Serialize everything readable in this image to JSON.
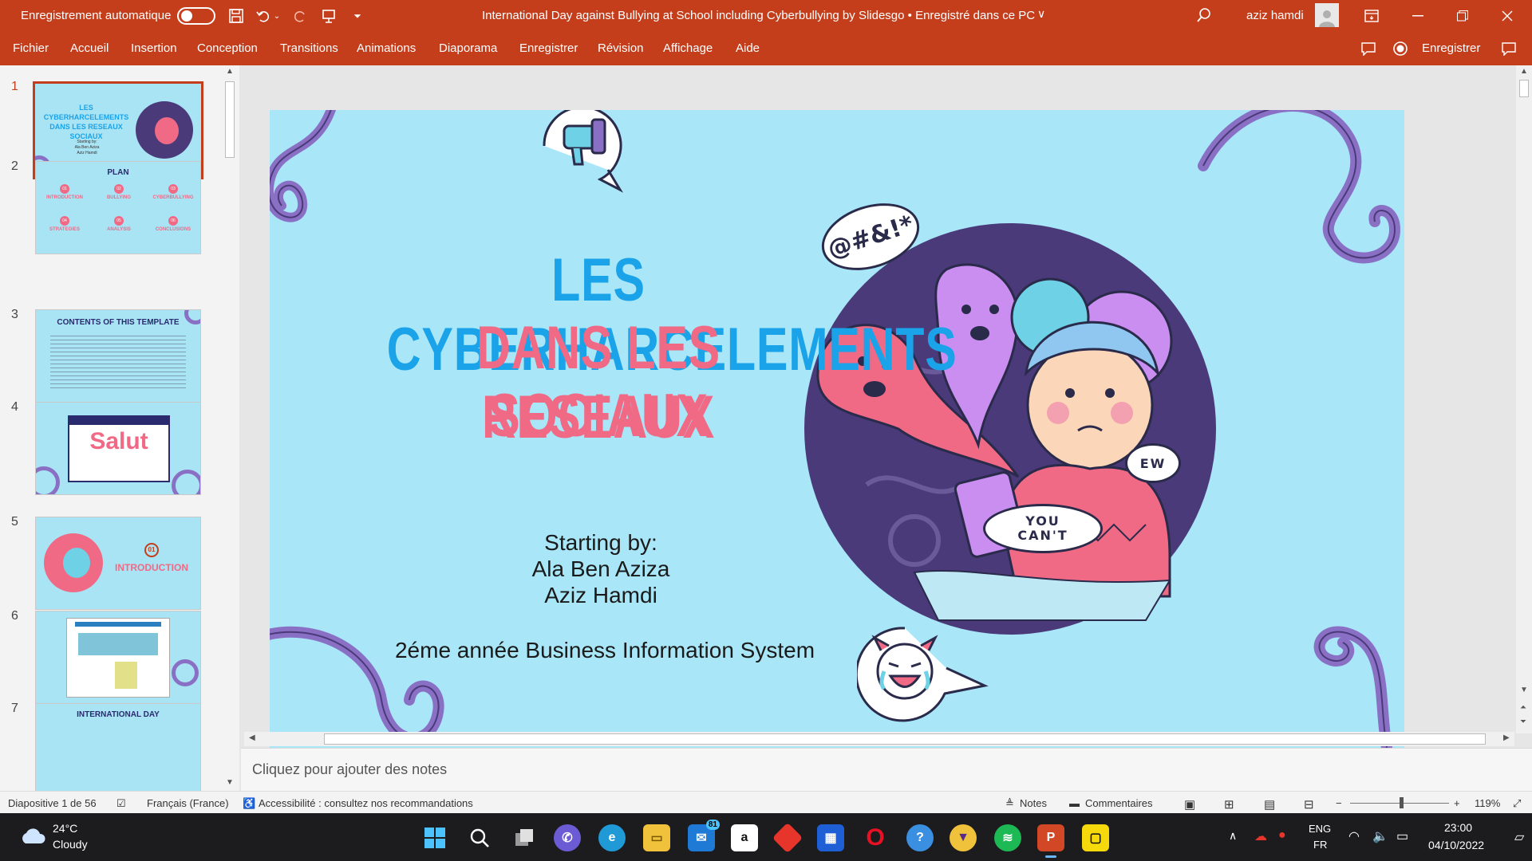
{
  "titlebar": {
    "autosave_label": "Enregistrement automatique",
    "document_title": "International Day against Bullying at School including Cyberbullying by Slidesgo • Enregistré dans ce PC",
    "user_name": "aziz hamdi"
  },
  "ribbon": {
    "tabs": [
      "Fichier",
      "Accueil",
      "Insertion",
      "Conception",
      "Transitions",
      "Animations",
      "Diaporama",
      "Enregistrer",
      "Révision",
      "Affichage",
      "Aide"
    ],
    "record_label": "Enregistrer"
  },
  "thumbnails": [
    {
      "number": "1",
      "title": "LES CYBERHARCELEMENTS DANS LES RESEAUX SOCIAUX"
    },
    {
      "number": "2",
      "title": "PLAN"
    },
    {
      "number": "3",
      "title": "CONTENTS OF THIS TEMPLATE"
    },
    {
      "number": "4",
      "title": "Salut"
    },
    {
      "number": "5",
      "title": "INTRODUCTION"
    },
    {
      "number": "6",
      "title": ""
    },
    {
      "number": "7",
      "title": "INTERNATIONAL DAY"
    }
  ],
  "thumb_details": {
    "slide1_authors": "Starting by:\nAla Ben Aziza\nAziz Hamdi",
    "slide2_items": [
      "01",
      "02",
      "03",
      "04",
      "05",
      "06"
    ],
    "slide2_labels": [
      "INTRODUCTION",
      "BULLYING",
      "CYBERBULLYING",
      "STRATEGIES",
      "ANALYSIS",
      "CONCLUSIONS"
    ],
    "slide5_number": "01"
  },
  "slide": {
    "title_line1": "LES CYBERHARCELEMENTS",
    "title_line2": "DANS LES RESEAUX",
    "title_line3": "SOCIAUX",
    "author_intro": "Starting by:",
    "author1": "Ala Ben Aziza",
    "author2": "Aziz Hamdi",
    "program": "2éme année Business Information System",
    "bubble1": "@#&!*",
    "bubble2": "EW",
    "bubble3_line1": "YOU",
    "bubble3_line2": "CAN'T",
    "colors": {
      "background": "#a8e6f8",
      "title_blue": "#1aa3e8",
      "title_pink": "#f06a86",
      "purple": "#8a70c4"
    }
  },
  "notes_placeholder": "Cliquez pour ajouter des notes",
  "statusbar": {
    "slide_counter": "Diapositive 1 de 56",
    "language": "Français (France)",
    "accessibility": "Accessibilité : consultez nos recommandations",
    "notes_label": "Notes",
    "comments_label": "Commentaires",
    "zoom": "119%"
  },
  "taskbar": {
    "weather_temp": "24°C",
    "weather_desc": "Cloudy",
    "mail_badge": "81",
    "lang_top": "ENG",
    "lang_bottom": "FR",
    "time": "23:00",
    "date": "04/10/2022"
  }
}
